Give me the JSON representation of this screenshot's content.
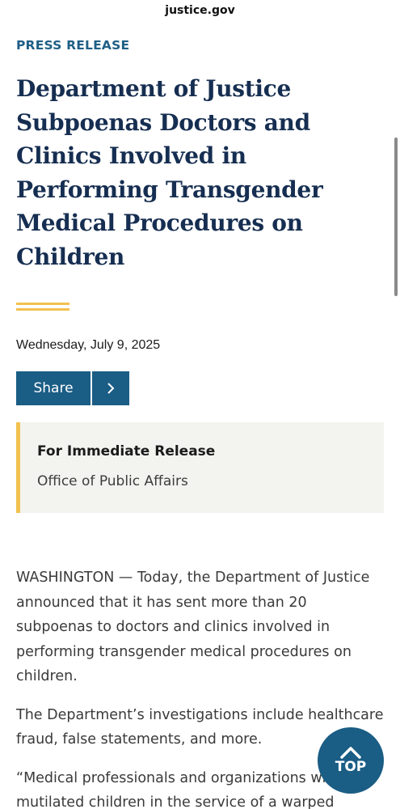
{
  "browser": {
    "url": "justice.gov"
  },
  "article": {
    "eyebrow": "PRESS RELEASE",
    "title": "Department of Justice Subpoenas Doctors and Clinics Involved in Performing Transgender Medical Procedures on Children",
    "date": "Wednesday, July 9, 2025",
    "share_label": "Share",
    "release_label": "For Immediate Release",
    "office": "Office of Public Affairs",
    "paragraphs": [
      "WASHINGTON — Today, the Department of Justice announced that it has sent more than 20 subpoenas to doctors and clinics involved in performing transgender medical procedures on children.",
      "The Department’s investigations include healthcare fraud, false statements, and more.",
      "“Medical professionals and organizations who mutilated children in the service of a warped ideology will be held accountable by this"
    ]
  },
  "top_button": {
    "label": "TOP"
  },
  "colors": {
    "accent_blue": "#1a5d85",
    "title_navy": "#162e51",
    "gold": "#f2c14e",
    "eyebrow_blue": "#1f5f86"
  },
  "icons": {
    "share_arrow": "chevron-right-icon",
    "top_arrow": "chevron-up-icon"
  }
}
